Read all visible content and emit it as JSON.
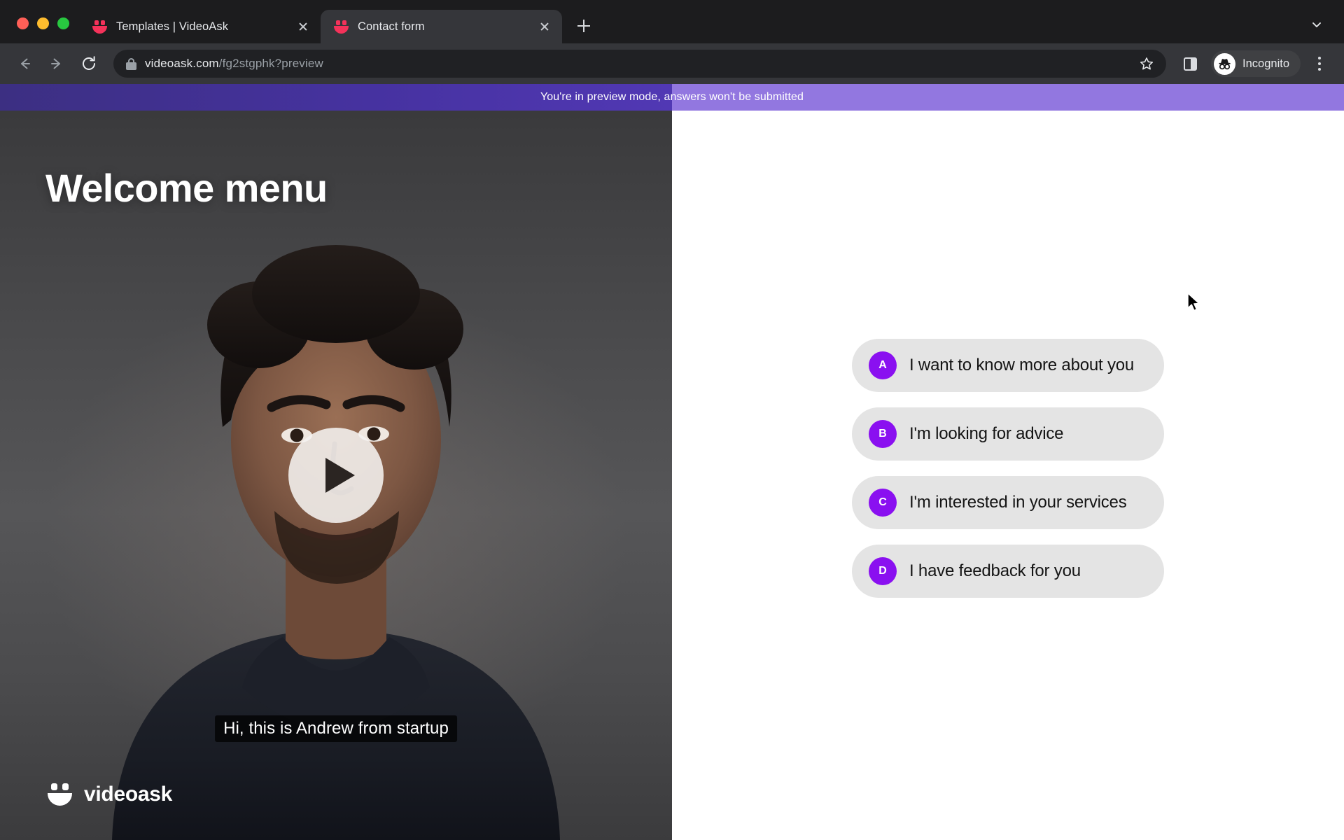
{
  "browser": {
    "traffic_lights": [
      "close",
      "minimize",
      "maximize"
    ],
    "tabs": [
      {
        "title": "Templates | VideoAsk",
        "favicon": "videoask-smiley-icon",
        "active": false
      },
      {
        "title": "Contact form",
        "favicon": "videoask-smiley-icon",
        "active": true
      }
    ],
    "new_tab_label": "+",
    "tab_list_chevron": "chevron-down-icon",
    "toolbar": {
      "back_icon": "back-arrow-icon",
      "forward_icon": "forward-arrow-icon",
      "reload_icon": "reload-icon",
      "lock_icon": "lock-icon",
      "url_domain": "videoask.com",
      "url_path": "/fg2stgphk?preview",
      "bookmark_icon": "star-icon",
      "side_panel_icon": "side-panel-icon",
      "profile_label": "Incognito",
      "profile_icon": "incognito-hat-icon",
      "menu_icon": "three-dots-menu-icon"
    },
    "colors": {
      "tabstrip_bg": "#1c1c1e",
      "toolbar_bg": "#35363a",
      "omnibox_bg": "#202124",
      "favicon_red": "#f4325a"
    }
  },
  "page": {
    "preview_banner": {
      "text": "You're in preview mode, answers won't be submitted",
      "bar_color": "#9277e0",
      "progress_color": "#4632a0",
      "progress_percent": 50
    },
    "video": {
      "title": "Welcome menu",
      "play_button_icon": "play-triangle-icon",
      "caption": "Hi, this is Andrew from startup",
      "brand_name": "videoask",
      "brand_icon": "videoask-smiley-icon"
    },
    "answers": {
      "options": [
        {
          "letter": "A",
          "label": "I want to know more about you"
        },
        {
          "letter": "B",
          "label": "I'm looking for advice"
        },
        {
          "letter": "C",
          "label": "I'm interested in your services"
        },
        {
          "letter": "D",
          "label": "I have feedback for you"
        }
      ],
      "badge_color": "#8a10f0",
      "button_bg": "#e4e4e4",
      "panel_bg": "#ffffff"
    }
  }
}
